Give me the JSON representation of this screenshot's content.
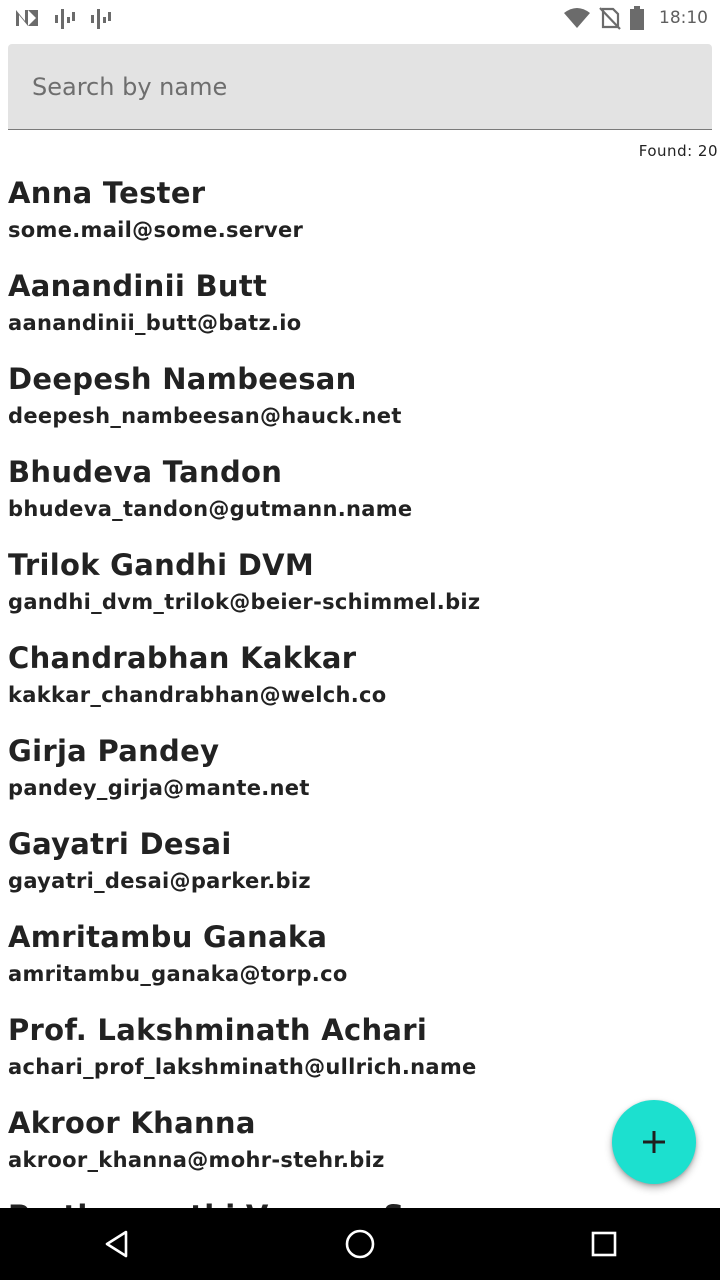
{
  "status_bar": {
    "time": "18:10",
    "icons": [
      "notification-n-icon",
      "signal-bars-icon",
      "signal-bars-icon",
      "wifi-icon",
      "no-sim-icon",
      "battery-icon"
    ]
  },
  "search": {
    "placeholder": "Search by name",
    "value": ""
  },
  "found_label": "Found: 20",
  "contacts": [
    {
      "name": "Anna Tester",
      "email": "some.mail@some.server"
    },
    {
      "name": "Aanandinii Butt",
      "email": "aanandinii_butt@batz.io"
    },
    {
      "name": "Deepesh Nambeesan",
      "email": "deepesh_nambeesan@hauck.net"
    },
    {
      "name": "Bhudeva Tandon",
      "email": "bhudeva_tandon@gutmann.name"
    },
    {
      "name": "Trilok Gandhi DVM",
      "email": "gandhi_dvm_trilok@beier-schimmel.biz"
    },
    {
      "name": "Chandrabhan Kakkar",
      "email": "kakkar_chandrabhan@welch.co"
    },
    {
      "name": "Girja Pandey",
      "email": "pandey_girja@mante.net"
    },
    {
      "name": "Gayatri Desai",
      "email": "gayatri_desai@parker.biz"
    },
    {
      "name": "Amritambu Ganaka",
      "email": "amritambu_ganaka@torp.co"
    },
    {
      "name": "Prof. Lakshminath Achari",
      "email": "achari_prof_lakshminath@ullrich.name"
    },
    {
      "name": "Akroor Khanna",
      "email": "akroor_khanna@mohr-stehr.biz"
    },
    {
      "name": "Parthasarathi Varman Sr.",
      "email": ""
    }
  ],
  "fab": {
    "icon": "plus-icon",
    "color": "#1ce0cf"
  },
  "nav_bar": {
    "icons": [
      "back-triangle-icon",
      "home-circle-icon",
      "recents-square-icon"
    ]
  }
}
